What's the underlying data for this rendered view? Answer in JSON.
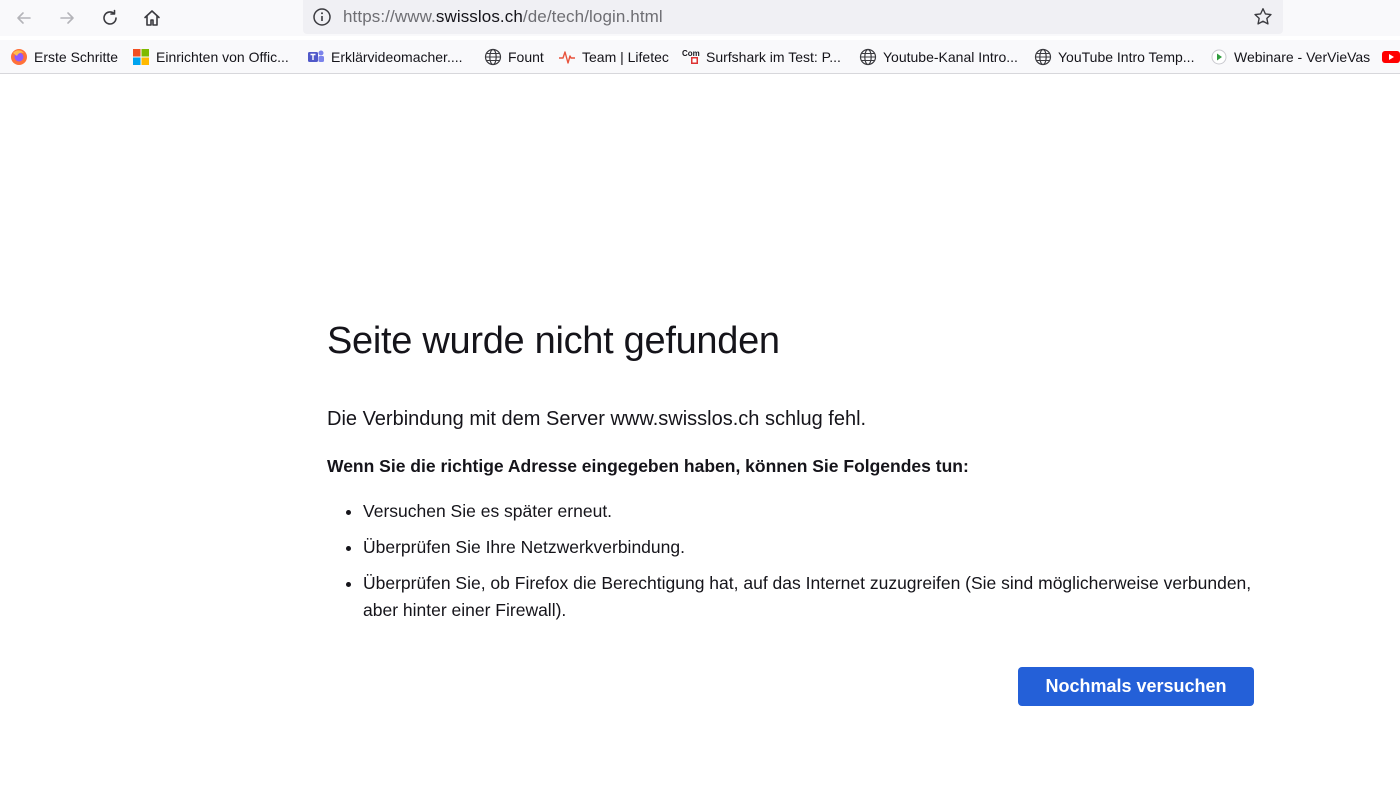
{
  "browser": {
    "url": {
      "prefix": "https://www.",
      "domain": "swisslos.ch",
      "path": "/de/tech/login.html"
    },
    "bookmarks": [
      {
        "label": "Erste Schritte",
        "icon": "firefox-icon"
      },
      {
        "label": "Einrichten von Offic...",
        "icon": "microsoft-icon"
      },
      {
        "label": "Erklärvideomacher....",
        "icon": "teams-icon"
      },
      {
        "label": "Fount",
        "icon": "globe-icon"
      },
      {
        "label": "Team | Lifetec",
        "icon": "lifetec-icon"
      },
      {
        "label": "Surfshark im Test: P...",
        "icon": "com-icon"
      },
      {
        "label": "Youtube-Kanal Intro...",
        "icon": "globe-icon"
      },
      {
        "label": "YouTube Intro Temp...",
        "icon": "globe-icon"
      },
      {
        "label": "Webinare - VerVieVas",
        "icon": "play-icon"
      }
    ],
    "colors": {
      "accent": "#2460d8",
      "toolbar": "#f9f9fb",
      "urlbar": "#f0f0f4"
    }
  },
  "error_page": {
    "title": "Seite wurde nicht gefunden",
    "description": "Die Verbindung mit dem Server www.swisslos.ch schlug fehl.",
    "subheading": "Wenn Sie die richtige Adresse eingegeben haben, können Sie Folgendes tun:",
    "tips": [
      "Versuchen Sie es später erneut.",
      "Überprüfen Sie Ihre Netzwerkverbindung.",
      "Überprüfen Sie, ob Firefox die Berechtigung hat, auf das Internet zuzugreifen (Sie sind möglicherweise verbunden, aber hinter einer Firewall)."
    ],
    "retry_label": "Nochmals versuchen"
  }
}
